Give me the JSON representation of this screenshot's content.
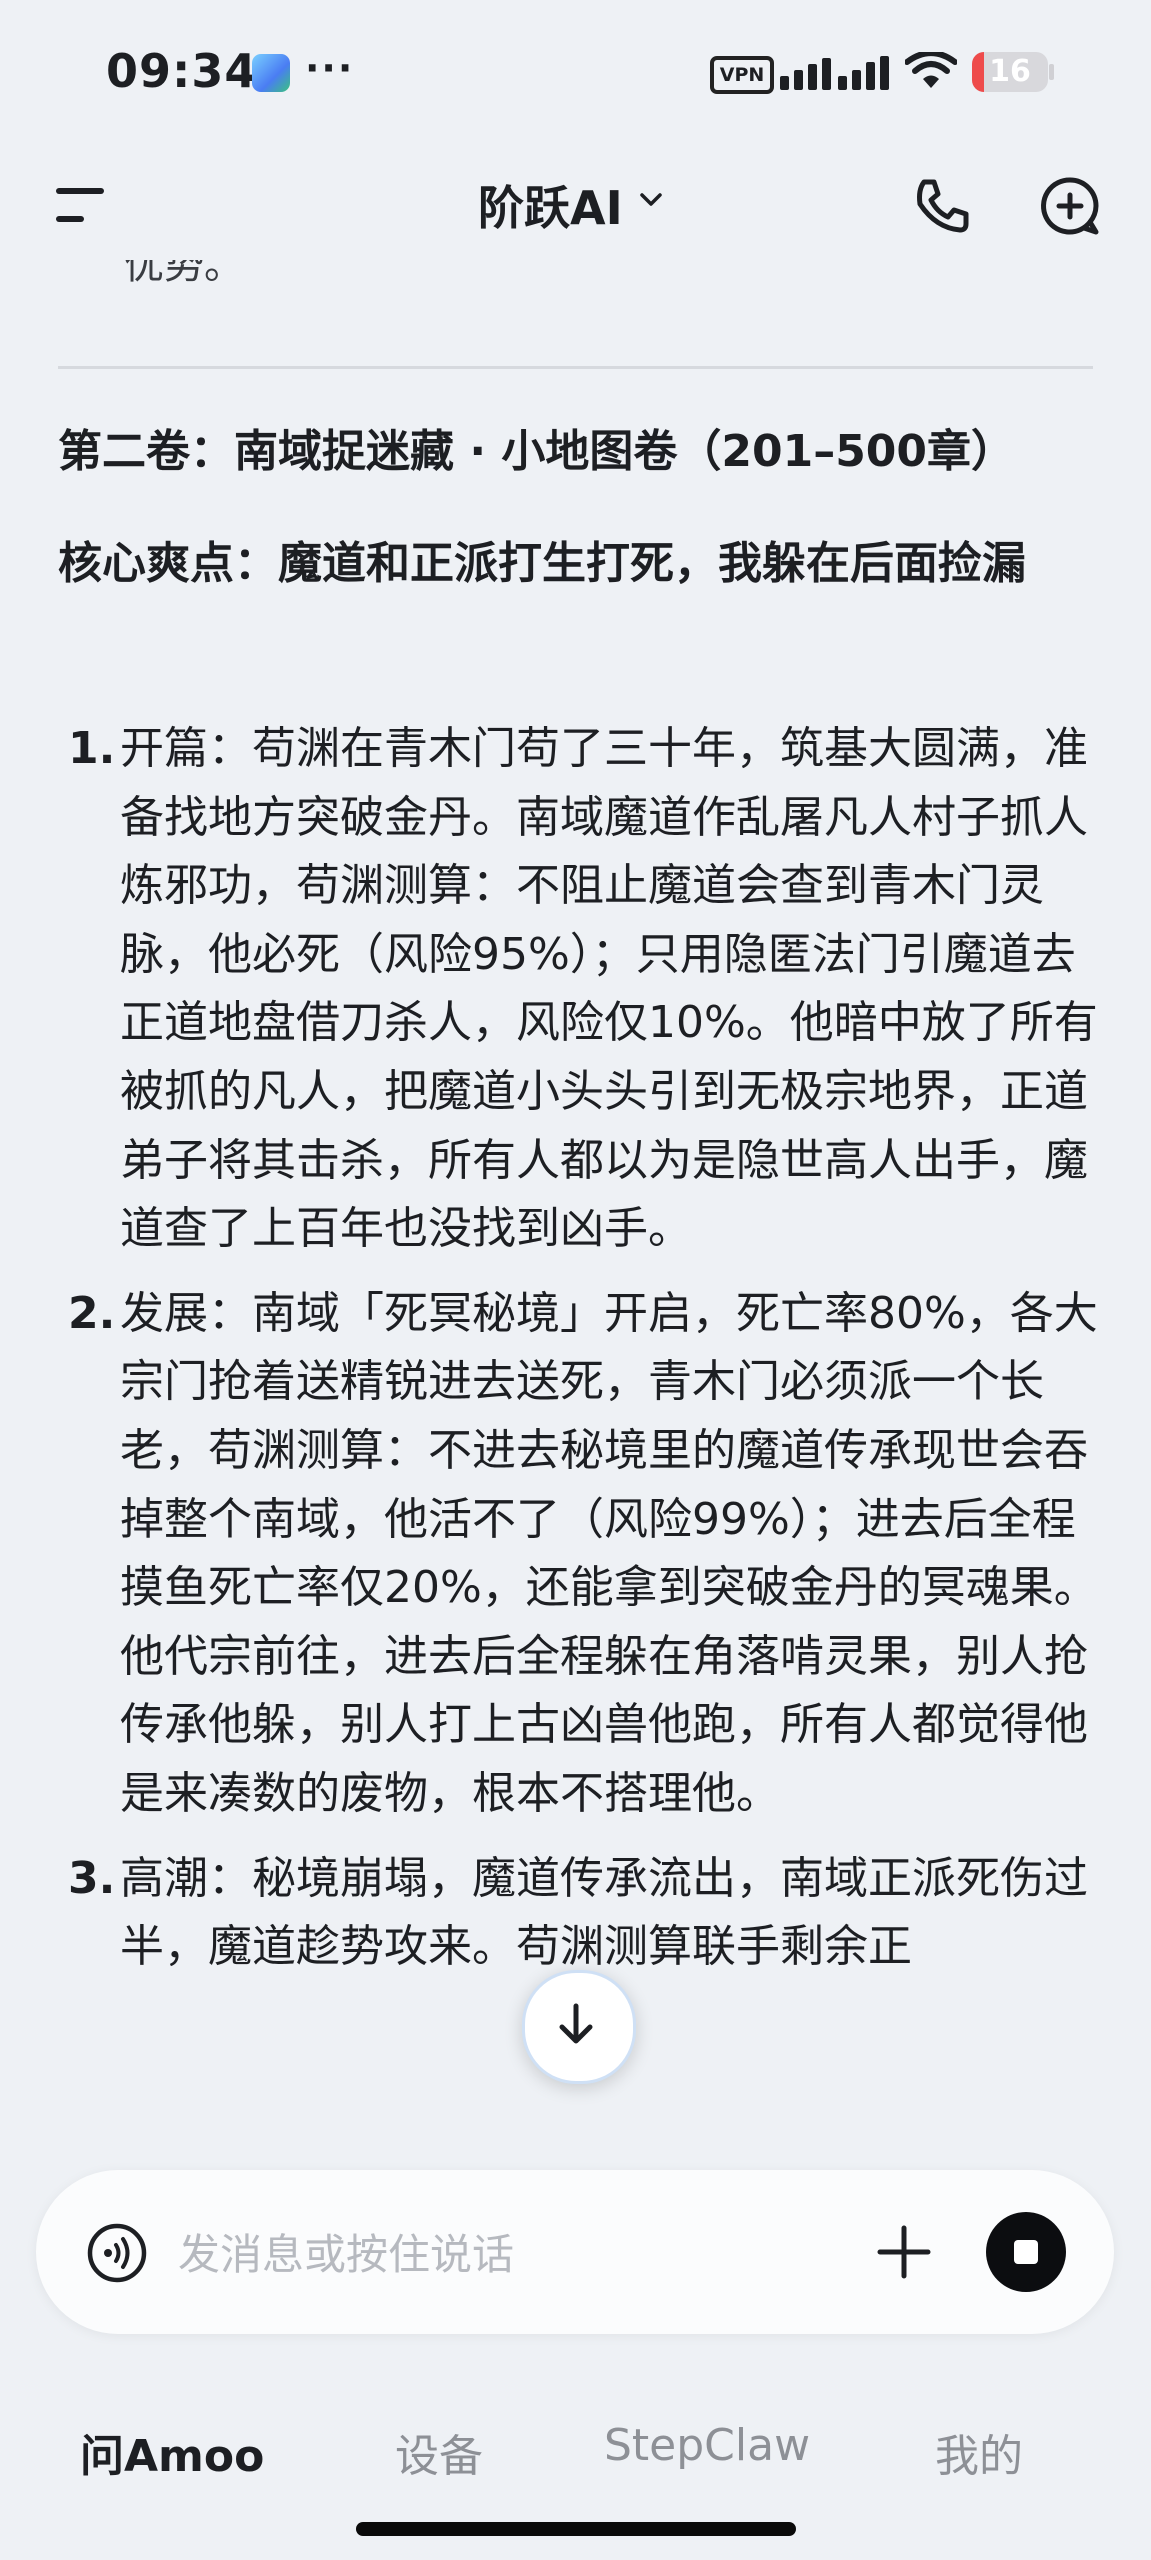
{
  "status_bar": {
    "time": "09:34",
    "more": "···",
    "vpn": "VPN",
    "battery_level": "16",
    "battery_fraction": 0.16
  },
  "header": {
    "title": "阶跃AI",
    "icons": [
      "menu-icon",
      "chevron-down-icon",
      "phone-icon",
      "new-chat-icon"
    ]
  },
  "chat": {
    "cut_off_text": "优势。",
    "section_title": "第二卷：南域捉迷藏 · 小地图卷（201–500章）",
    "highlight": "核心爽点：魔道和正派打生打死，我躲在后面捡漏",
    "items": [
      {
        "num": "1.",
        "text": "开篇：苟渊在青木门苟了三十年，筑基大圆满，准备找地方突破金丹。南域魔道作乱屠凡人村子抓人炼邪功，苟渊测算：不阻止魔道会查到青木门灵脉，他必死（风险95%）；只用隐匿法门引魔道去正道地盘借刀杀人，风险仅10%。他暗中放了所有被抓的凡人，把魔道小头头引到无极宗地界，正道弟子将其击杀，所有人都以为是隐世高人出手，魔道查了上百年也没找到凶手。"
      },
      {
        "num": "2.",
        "text": "发展：南域「死冥秘境」开启，死亡率80%，各大宗门抢着送精锐进去送死，青木门必须派一个长老，苟渊测算：不进去秘境里的魔道传承现世会吞掉整个南域，他活不了（风险99%）；进去后全程摸鱼死亡率仅20%，还能拿到突破金丹的冥魂果。他代宗前往，进去后全程躲在角落啃灵果，别人抢传承他躲，别人打上古凶兽他跑，所有人都觉得他是来凑数的废物，根本不搭理他。"
      },
      {
        "num": "3.",
        "text": "高潮：秘境崩塌，魔道传承流出，南域正派死伤过半，魔道趁势攻来。苟渊测算联手剩余正"
      }
    ]
  },
  "input": {
    "placeholder": "发消息或按住说话",
    "icons": [
      "voice-icon",
      "plus-icon",
      "stop-icon"
    ]
  },
  "scroll_button": {
    "icon": "arrow-down-icon"
  },
  "bottom_nav": {
    "tabs": [
      {
        "label": "问Amoo",
        "active": true
      },
      {
        "label": "设备",
        "active": false
      },
      {
        "label": "StepClaw",
        "active": false
      },
      {
        "label": "我的",
        "active": false
      }
    ]
  }
}
